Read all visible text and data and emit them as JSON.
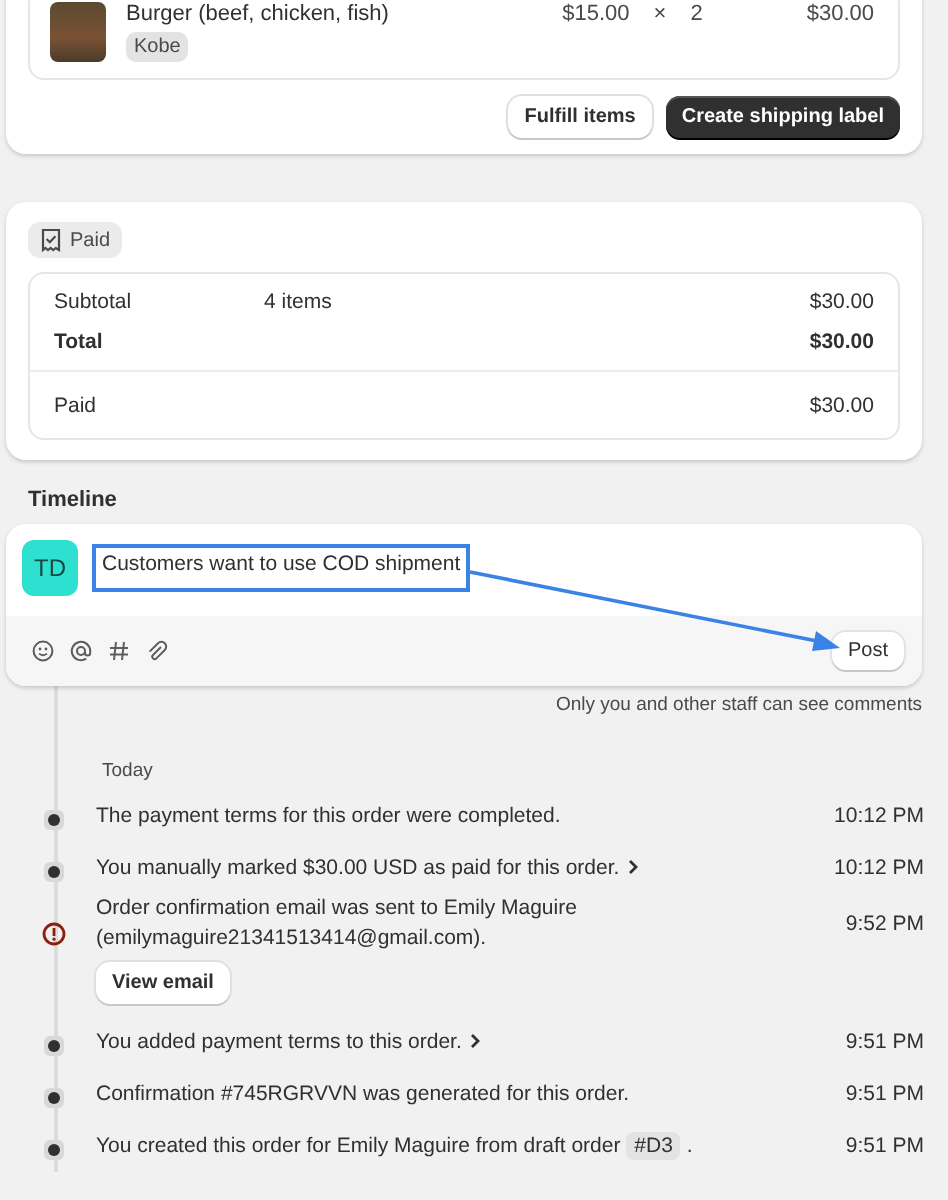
{
  "fulfillment": {
    "item": {
      "title": "Burger (beef, chicken, fish)",
      "variant": "Kobe",
      "price": "$15.00",
      "times": "×",
      "quantity": "2",
      "total": "$30.00"
    },
    "buttons": [
      {
        "label": "Fulfill items",
        "kind": "secondary"
      },
      {
        "label": "Create shipping label",
        "kind": "primary"
      }
    ]
  },
  "payment": {
    "status": "Paid",
    "rows": [
      {
        "label": "Subtotal",
        "detail": "4 items",
        "amount": "$30.00",
        "bold": false,
        "divider_before": false
      },
      {
        "label": "Total",
        "amount": "$30.00",
        "bold": true,
        "divider_before": false
      },
      {
        "label": "Paid",
        "amount": "$30.00",
        "bold": false,
        "divider_before": true
      }
    ]
  },
  "timeline": {
    "title": "Timeline",
    "comment": {
      "avatar": "TD",
      "value": "Customers want to use COD shipment",
      "highlighted": true,
      "arrow_to_post": true,
      "post_button": "Post",
      "note": "Only you and other staff can see comments"
    },
    "day": "Today",
    "events": [
      {
        "kind": "dot",
        "text": "The payment terms for this order were completed.",
        "time": "10:12 PM",
        "expandable": false
      },
      {
        "kind": "dot",
        "text": "You manually marked $30.00 USD as paid for this order.",
        "time": "10:12 PM",
        "expandable": true
      },
      {
        "kind": "alert",
        "text": "Order confirmation email was sent to Emily Maguire (emilymaguire21341513414@gmail.com).",
        "time": "9:52 PM",
        "expandable": false,
        "button": "View email"
      },
      {
        "kind": "dot",
        "text": "You added payment terms to this order.",
        "time": "9:51 PM",
        "expandable": true
      },
      {
        "kind": "dot",
        "text": "Confirmation #745RGRVVN was generated for this order.",
        "time": "9:51 PM",
        "expandable": false
      },
      {
        "kind": "dot",
        "text": "You created this order for Emily Maguire from draft order",
        "tag": "#D3",
        "suffix": ".",
        "time": "9:51 PM",
        "expandable": false
      }
    ]
  }
}
